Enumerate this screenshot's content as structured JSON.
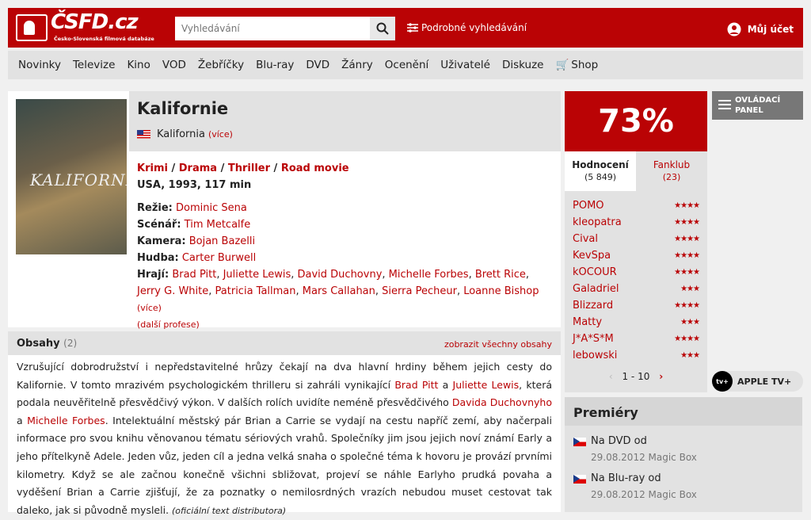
{
  "header": {
    "brand": "ČSFD.cz",
    "tagline": "Česko-Slovenská filmová databáze",
    "search_placeholder": "Vyhledávání",
    "advanced_search": "Podrobné vyhledávání",
    "account": "Můj účet"
  },
  "nav": [
    "Novinky",
    "Televize",
    "Kino",
    "VOD",
    "Žebříčky",
    "Blu-ray",
    "DVD",
    "Žánry",
    "Ocenění",
    "Uživatelé",
    "Diskuze",
    "Shop"
  ],
  "film": {
    "title": "Kalifornie",
    "orig_title": "Kalifornia",
    "more": "(více)",
    "poster_title": "KALIFORNIE",
    "genres": [
      "Krimi",
      "Drama",
      "Thriller",
      "Road movie"
    ],
    "origin": "USA, 1993, 117 min",
    "directing_label": "Režie:",
    "director": "Dominic Sena",
    "writing_label": "Scénář:",
    "writer": "Tim Metcalfe",
    "camera_label": "Kamera:",
    "camera": "Bojan Bazelli",
    "music_label": "Hudba:",
    "music": "Carter Burwell",
    "cast_label": "Hrají:",
    "cast": [
      "Brad Pitt",
      "Juliette Lewis",
      "David Duchovny",
      "Michelle Forbes",
      "Brett Rice",
      "Jerry G. White",
      "Patricia Tallman",
      "Mars Callahan",
      "Sierra Pecheur",
      "Loanne Bishop"
    ],
    "cast_more": "(více)",
    "other_prof": "(další profese)"
  },
  "plot": {
    "heading": "Obsahy",
    "count": "(2)",
    "show_all": "zobrazit všechny obsahy",
    "p1": "Vzrušující dobrodružství i nepředstavitelné hrůzy čekají na dva hlavní hrdiny během jejich cesty do Kalifornie. V tomto mrazivém psychologickém thrilleru si zahráli vynikající ",
    "l1": "Brad Pitt",
    "p2": " a ",
    "l2": "Juliette Lewis",
    "p3": ", která podala neuvěřitelně přesvědčivý výkon. V dalších rolích uvidíte neméně přesvědčivého ",
    "l3": "Davida Duchovnyho",
    "p4": " a ",
    "l4": "Michelle Forbes",
    "p5": ". Intelektuální městský pár Brian a Carrie se vydají na cestu napříč zemí, aby načerpali informace pro svou knihu věnovanou tématu sériových vrahů. Společníky jim jsou jejich noví známí Early a jeho přítelkyně Adele. Jeden vůz, jeden cíl a jedna velká snaha o společné téma k hovoru je provází prvními kilometry. Když se ale začnou konečně všichni sbližovat, projeví se náhle Earlyho prudká povaha a vyděšení Brian a Carrie zjišťují, že za poznatky o nemilosrdných vrazích nebudou muset cestovat tak daleko, jak si původně mysleli. ",
    "source": "(oficiální text distributora)"
  },
  "rating": {
    "percent": "73%",
    "tab1": "Hodnocení",
    "tab1_count": "(5 849)",
    "tab2": "Fanklub",
    "tab2_count": "(23)",
    "users": [
      {
        "name": "POMO",
        "stars": "★★★★"
      },
      {
        "name": "kleopatra",
        "stars": "★★★★"
      },
      {
        "name": "Cival",
        "stars": "★★★★"
      },
      {
        "name": "KevSpa",
        "stars": "★★★★"
      },
      {
        "name": "kOCOUR",
        "stars": "★★★★"
      },
      {
        "name": "Galadriel",
        "stars": "★★★"
      },
      {
        "name": "Blizzard",
        "stars": "★★★★"
      },
      {
        "name": "Matty",
        "stars": "★★★"
      },
      {
        "name": "J*A*S*M",
        "stars": "★★★★"
      },
      {
        "name": "lebowski",
        "stars": "★★★"
      }
    ],
    "pager": "1 - 10"
  },
  "side": {
    "panel": "OVLÁDACÍ PANEL",
    "appletv": "APPLE TV+",
    "appletv_icon": "tv+"
  },
  "premieres": {
    "heading": "Premiéry",
    "items": [
      {
        "type": "Na DVD od",
        "date": "29.08.2012 Magic Box"
      },
      {
        "type": "Na Blu-ray od",
        "date": "29.08.2012 Magic Box"
      }
    ]
  }
}
